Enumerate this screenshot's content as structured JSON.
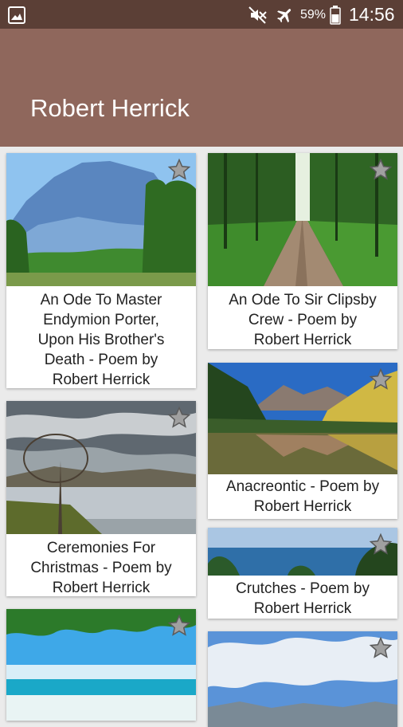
{
  "status_bar": {
    "battery": "59%",
    "time": "14:56",
    "icons": [
      "gallery-icon",
      "mute-icon",
      "airplane-icon",
      "battery-icon"
    ]
  },
  "app_bar": {
    "title": "Robert Herrick"
  },
  "cards": [
    {
      "caption_lines": [
        "An Ode To Master",
        "Endymion Porter,",
        "Upon His Brother's",
        "Death - Poem by",
        "Robert Herrick"
      ],
      "image": "mountain-landscape"
    },
    {
      "caption_lines": [
        "An Ode To Sir Clipsby",
        "Crew - Poem by",
        "Robert Herrick"
      ],
      "image": "forest-path"
    },
    {
      "caption_lines": [
        "Ceremonies For",
        "Christmas - Poem by",
        "Robert Herrick"
      ],
      "image": "cloudy-lake"
    },
    {
      "caption_lines": [
        "Anacreontic - Poem by",
        "Robert Herrick"
      ],
      "image": "mountain-lake-reflection"
    },
    {
      "caption_lines": [
        "Crutches - Poem by",
        "Robert Herrick"
      ],
      "image": "sea-horizon"
    },
    {
      "caption_lines": [],
      "image": "tropical-beach"
    },
    {
      "caption_lines": [],
      "image": "cloudy-sky-mountains"
    }
  ],
  "colors": {
    "status_bar": "#5b3f36",
    "app_bar": "#8f675c",
    "background": "#ebebeb"
  }
}
